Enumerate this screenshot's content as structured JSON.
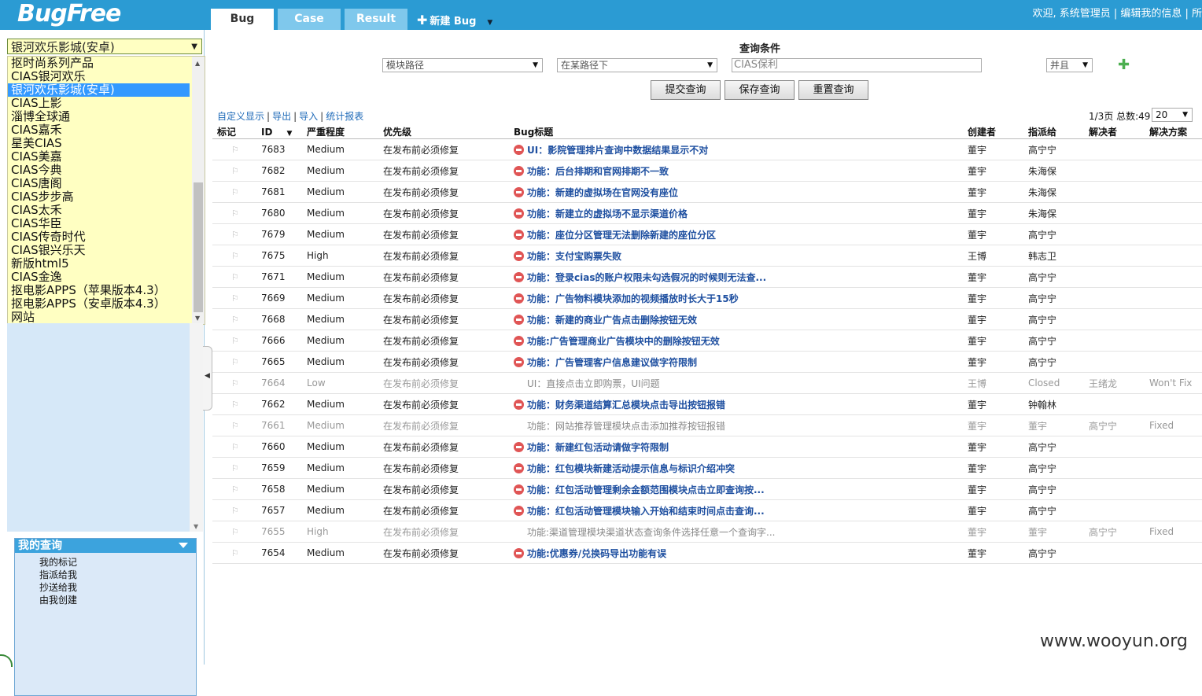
{
  "app": {
    "logo": "BugFree",
    "tabs": [
      {
        "label": "Bug"
      },
      {
        "label": "Case"
      },
      {
        "label": "Result"
      }
    ],
    "new_bug": {
      "label": "新建 Bug"
    },
    "welcome": "欢迎, 系统管理员 | 编辑我的信息 | 所"
  },
  "sidebar": {
    "product_selected": "银河欢乐影城(安卓)",
    "products": [
      "抠时尚系列产品",
      "CIAS银河欢乐",
      "银河欢乐影城(安卓)",
      "CIAS上影",
      "淄博全球通",
      "CIAS嘉禾",
      "星美CIAS",
      "CIAS美嘉",
      "CIAS今典",
      "CIAS唐阁",
      "CIAS步步高",
      "CIAS太禾",
      "CIAS华臣",
      "CIAS传奇时代",
      "CIAS银兴乐天",
      "新版html5",
      "CIAS金逸",
      "抠电影APPS（苹果版本4.3）",
      "抠电影APPS（安卓版本4.3）",
      "网站"
    ],
    "selected_index": 2,
    "my_query": {
      "title": "我的查询",
      "items": [
        "我的标记",
        "指派给我",
        "抄送给我",
        "由我创建"
      ]
    }
  },
  "query": {
    "title": "查询条件",
    "field": "模块路径",
    "operator": "在某路径下",
    "value": "CIAS保利",
    "logic": "并且",
    "buttons": {
      "submit": "提交查询",
      "save": "保存查询",
      "reset": "重置查询"
    }
  },
  "toolbar": {
    "links": [
      "自定义显示",
      "导出",
      "导入",
      "统计报表"
    ],
    "pager": "1/3页 总数:49",
    "page_size": "20"
  },
  "table": {
    "headers": [
      "标记",
      "ID",
      "严重程度",
      "优先级",
      "Bug标题",
      "创建者",
      "指派给",
      "解决者",
      "解决方案"
    ],
    "rows": [
      {
        "id": "7683",
        "severity": "Medium",
        "priority": "在发布前必须修复",
        "title": "UI：影院管理排片查询中数据结果显示不对",
        "creator": "董宇",
        "assignee": "高宁宁",
        "resolver": "",
        "resolution": "",
        "active": true
      },
      {
        "id": "7682",
        "severity": "Medium",
        "priority": "在发布前必须修复",
        "title": "功能：后台排期和官网排期不一致",
        "creator": "董宇",
        "assignee": "朱海保",
        "resolver": "",
        "resolution": "",
        "active": true
      },
      {
        "id": "7681",
        "severity": "Medium",
        "priority": "在发布前必须修复",
        "title": "功能：新建的虚拟场在官网没有座位",
        "creator": "董宇",
        "assignee": "朱海保",
        "resolver": "",
        "resolution": "",
        "active": true
      },
      {
        "id": "7680",
        "severity": "Medium",
        "priority": "在发布前必须修复",
        "title": "功能：新建立的虚拟场不显示渠道价格",
        "creator": "董宇",
        "assignee": "朱海保",
        "resolver": "",
        "resolution": "",
        "active": true
      },
      {
        "id": "7679",
        "severity": "Medium",
        "priority": "在发布前必须修复",
        "title": "功能：座位分区管理无法删除新建的座位分区",
        "creator": "董宇",
        "assignee": "高宁宁",
        "resolver": "",
        "resolution": "",
        "active": true
      },
      {
        "id": "7675",
        "severity": "High",
        "priority": "在发布前必须修复",
        "title": "功能：支付宝购票失败",
        "creator": "王博",
        "assignee": "韩志卫",
        "resolver": "",
        "resolution": "",
        "active": true
      },
      {
        "id": "7671",
        "severity": "Medium",
        "priority": "在发布前必须修复",
        "title": "功能：登录cias的账户权限未勾选假况的时候则无法查...",
        "creator": "董宇",
        "assignee": "高宁宁",
        "resolver": "",
        "resolution": "",
        "active": true
      },
      {
        "id": "7669",
        "severity": "Medium",
        "priority": "在发布前必须修复",
        "title": "功能：广告物料模块添加的视频播放时长大于15秒",
        "creator": "董宇",
        "assignee": "高宁宁",
        "resolver": "",
        "resolution": "",
        "active": true
      },
      {
        "id": "7668",
        "severity": "Medium",
        "priority": "在发布前必须修复",
        "title": "功能：新建的商业广告点击删除按钮无效",
        "creator": "董宇",
        "assignee": "高宁宁",
        "resolver": "",
        "resolution": "",
        "active": true
      },
      {
        "id": "7666",
        "severity": "Medium",
        "priority": "在发布前必须修复",
        "title": "功能:广告管理商业广告模块中的删除按钮无效",
        "creator": "董宇",
        "assignee": "高宁宁",
        "resolver": "",
        "resolution": "",
        "active": true
      },
      {
        "id": "7665",
        "severity": "Medium",
        "priority": "在发布前必须修复",
        "title": "功能：广告管理客户信息建议做字符限制",
        "creator": "董宇",
        "assignee": "高宁宁",
        "resolver": "",
        "resolution": "",
        "active": true
      },
      {
        "id": "7664",
        "severity": "Low",
        "priority": "在发布前必须修复",
        "title": "UI：直接点击立即购票，UI问题",
        "creator": "王博",
        "assignee": "Closed",
        "resolver": "王绪龙",
        "resolution": "Won't Fix",
        "active": false
      },
      {
        "id": "7662",
        "severity": "Medium",
        "priority": "在发布前必须修复",
        "title": "功能：财务渠道结算汇总模块点击导出按钮报错",
        "creator": "董宇",
        "assignee": "钟翰林",
        "resolver": "",
        "resolution": "",
        "active": true
      },
      {
        "id": "7661",
        "severity": "Medium",
        "priority": "在发布前必须修复",
        "title": "功能：网站推荐管理模块点击添加推荐按钮报错",
        "creator": "董宇",
        "assignee": "董宇",
        "resolver": "高宁宁",
        "resolution": "Fixed",
        "active": false
      },
      {
        "id": "7660",
        "severity": "Medium",
        "priority": "在发布前必须修复",
        "title": "功能：新建红包活动请做字符限制",
        "creator": "董宇",
        "assignee": "高宁宁",
        "resolver": "",
        "resolution": "",
        "active": true
      },
      {
        "id": "7659",
        "severity": "Medium",
        "priority": "在发布前必须修复",
        "title": "功能：红包模块新建活动提示信息与标识介绍冲突",
        "creator": "董宇",
        "assignee": "高宁宁",
        "resolver": "",
        "resolution": "",
        "active": true
      },
      {
        "id": "7658",
        "severity": "Medium",
        "priority": "在发布前必须修复",
        "title": "功能：红包活动管理剩余金额范围模块点击立即查询按...",
        "creator": "董宇",
        "assignee": "高宁宁",
        "resolver": "",
        "resolution": "",
        "active": true
      },
      {
        "id": "7657",
        "severity": "Medium",
        "priority": "在发布前必须修复",
        "title": "功能：红包活动管理模块输入开始和结束时间点击查询...",
        "creator": "董宇",
        "assignee": "高宁宁",
        "resolver": "",
        "resolution": "",
        "active": true
      },
      {
        "id": "7655",
        "severity": "High",
        "priority": "在发布前必须修复",
        "title": "功能:渠道管理模块渠道状态查询条件选择任意一个查询字...",
        "creator": "董宇",
        "assignee": "董宇",
        "resolver": "高宁宁",
        "resolution": "Fixed",
        "active": false
      },
      {
        "id": "7654",
        "severity": "Medium",
        "priority": "在发布前必须修复",
        "title": "功能:优惠券/兑换码导出功能有误",
        "creator": "董宇",
        "assignee": "高宁宁",
        "resolver": "",
        "resolution": "",
        "active": true
      }
    ]
  },
  "watermark": "www.wooyun.org"
}
